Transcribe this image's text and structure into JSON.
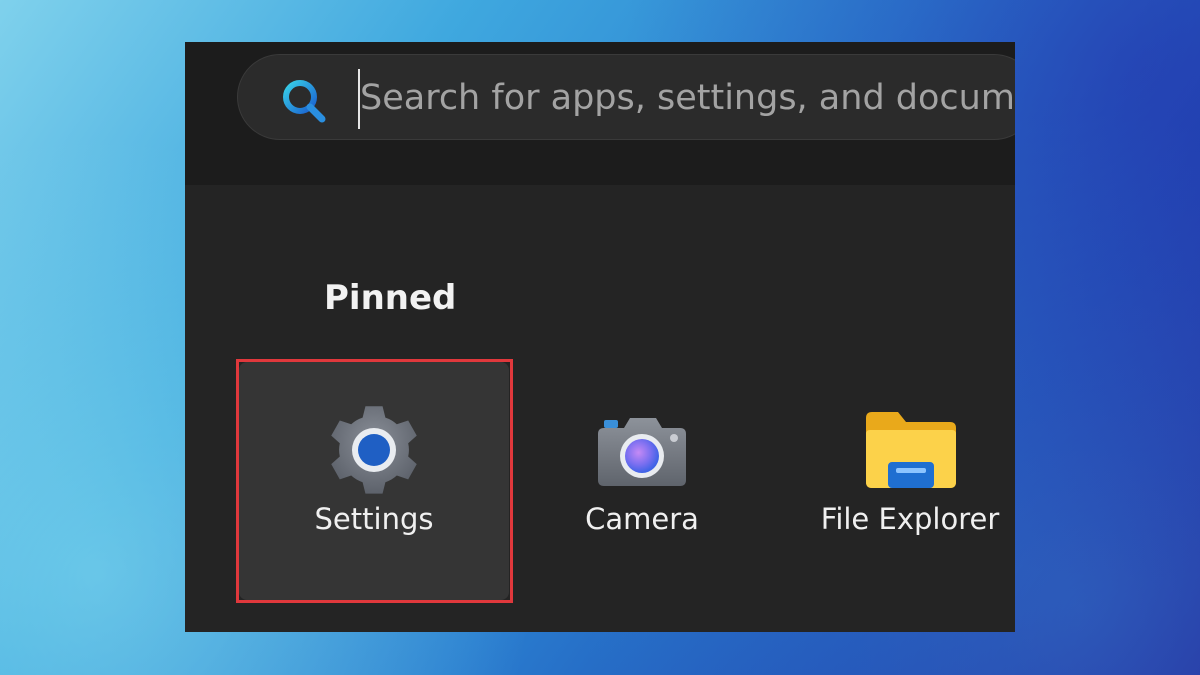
{
  "search": {
    "placeholder": "Search for apps, settings, and docume",
    "icon": "search-icon"
  },
  "pinned": {
    "heading": "Pinned",
    "apps": [
      {
        "label": "Settings",
        "icon": "gear-icon",
        "highlighted": true
      },
      {
        "label": "Camera",
        "icon": "camera-icon",
        "highlighted": false
      },
      {
        "label": "File Explorer",
        "icon": "folder-icon",
        "highlighted": false
      }
    ]
  },
  "colors": {
    "menu_background": "#242424",
    "search_strip": "#1c1c1c",
    "highlight_border": "#e0383c",
    "accent_blue": "#1f5fc4"
  }
}
